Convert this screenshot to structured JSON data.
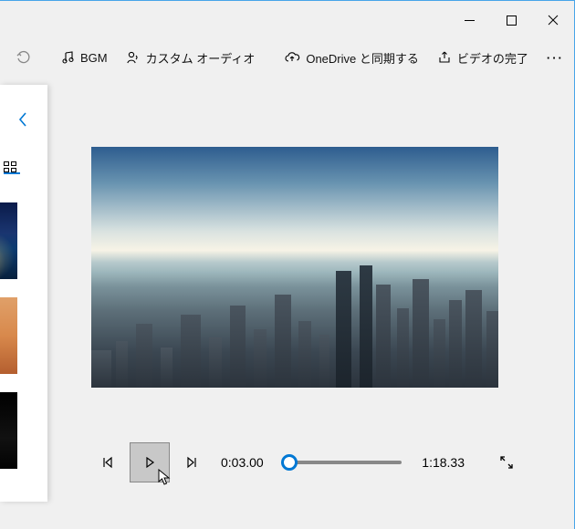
{
  "titlebar": {
    "minimize": "minimize",
    "maximize": "maximize",
    "close": "close"
  },
  "toolbar": {
    "undo_label": "",
    "bgm_label": "BGM",
    "custom_audio_label": "カスタム オーディオ",
    "onedrive_label": "OneDrive と同期する",
    "finish_label": "ビデオの完了",
    "more_label": "···"
  },
  "sidebar": {
    "back_label": "back"
  },
  "player": {
    "prev_frame_label": "prev-frame",
    "play_label": "play",
    "next_frame_label": "next-frame",
    "current_time": "0:03.00",
    "total_time": "1:18.33",
    "progress_percent": 5,
    "fullscreen_label": "fullscreen"
  }
}
